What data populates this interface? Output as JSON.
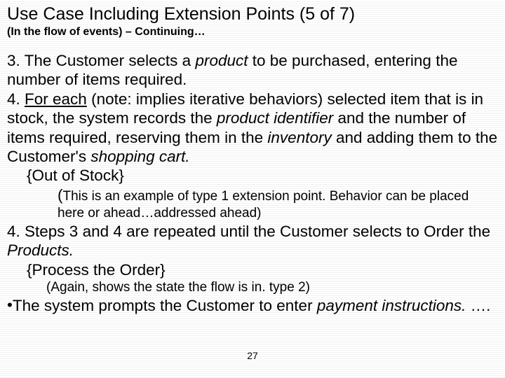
{
  "title": "Use Case Including Extension Points (5 of 7)",
  "subtitle": "(In the flow of events) – Continuing…",
  "step3_a": "3. The Customer selects a ",
  "step3_b": "product",
  "step3_c": " to be purchased, entering the number of items required.",
  "step4_a": "4. ",
  "step4_b": "For each",
  "step4_c": " (note:  implies iterative behaviors) selected item that is in stock, the system records the ",
  "step4_d": "product identifier",
  "step4_e": " and the number of items required, reserving them in the ",
  "step4_f": "inventory",
  "step4_g": " and adding them to the Customer's ",
  "step4_h": "shopping cart.",
  "ext1": "{Out of Stock}",
  "note1_a": "(",
  "note1_b": "This is an example of type 1 extension point.  Behavior can be placed here or ahead…addressed ahead)",
  "step4r_a": "4. Steps 3 and 4 are repeated until the Customer selects to Order the ",
  "step4r_b": "Products.",
  "ext2": "{Process the Order}",
  "note2": "(Again, shows the state the flow is in. type 2)",
  "bullet_a": "The system prompts the Customer to enter ",
  "bullet_b": "payment instructions.",
  "bullet_c": " ….",
  "pagenum": "27"
}
